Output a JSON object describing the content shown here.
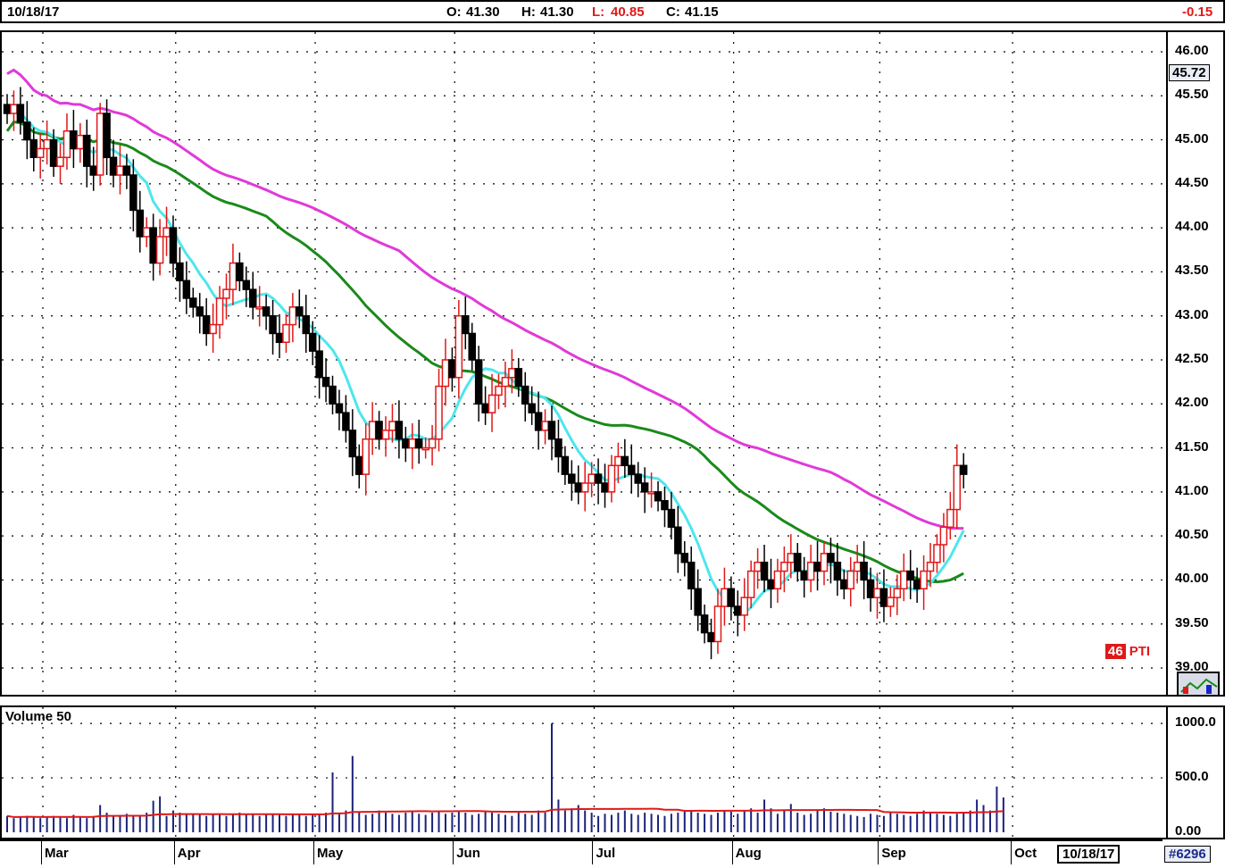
{
  "header": {
    "date": "10/18/17",
    "open_label": "O:",
    "open": "41.30",
    "high_label": "H:",
    "high": "41.30",
    "low_label": "L:",
    "low": "40.85",
    "close_label": "C:",
    "close": "41.15",
    "change": "-0.15"
  },
  "colors": {
    "up_bar": "#e01818",
    "down_bar": "#000000",
    "cyan_ma": "#4ee6ee",
    "green_ma": "#1a8a1a",
    "magenta_ma": "#e03ad8",
    "wave_blue": "#1b22c8",
    "wave_red": "#e01818"
  },
  "price_axis": {
    "ticks": [
      "46.00",
      "45.50",
      "45.00",
      "44.50",
      "44.00",
      "43.50",
      "43.00",
      "42.50",
      "42.00",
      "41.50",
      "41.00",
      "40.50",
      "40.00",
      "39.50",
      "39.00"
    ],
    "current": "45.72"
  },
  "volume_panel": {
    "title": "Volume 50",
    "ticks": [
      "1000.0",
      "500.0",
      "0.00"
    ]
  },
  "x_axis": {
    "months": [
      "Mar",
      "Apr",
      "May",
      "Jun",
      "Jul",
      "Aug",
      "Sep",
      "Oct"
    ],
    "current_date": "10/18/17",
    "id": "#6296"
  },
  "indicator": {
    "value": "46",
    "label": "PTI"
  },
  "chart_data": {
    "type": "bar",
    "title": "",
    "ylim": [
      38.95,
      46.25
    ],
    "volume_ylim": [
      0,
      1050
    ],
    "grid": true,
    "bar_count": 165,
    "month_start_index": [
      0,
      20,
      41,
      62,
      83,
      104,
      126,
      146
    ],
    "close": [
      45.3,
      45.4,
      45.2,
      45.0,
      44.8,
      44.9,
      45.0,
      44.7,
      44.8,
      45.1,
      44.9,
      45.05,
      44.7,
      44.6,
      45.3,
      44.8,
      44.6,
      44.7,
      44.6,
      44.2,
      43.9,
      44.0,
      43.6,
      43.9,
      44.0,
      43.6,
      43.4,
      43.2,
      43.1,
      43.0,
      42.8,
      42.9,
      43.2,
      43.3,
      43.6,
      43.4,
      43.3,
      43.1,
      43.1,
      43.0,
      42.8,
      42.7,
      42.9,
      43.1,
      43.0,
      42.8,
      42.6,
      42.3,
      42.2,
      42.0,
      41.9,
      41.7,
      41.4,
      41.2,
      41.6,
      41.8,
      41.6,
      41.7,
      41.8,
      41.6,
      41.5,
      41.6,
      41.5,
      41.5,
      41.6,
      42.2,
      42.5,
      42.3,
      43.0,
      42.8,
      42.5,
      42.0,
      41.9,
      42.1,
      42.2,
      42.3,
      42.4,
      42.2,
      42.0,
      41.9,
      41.7,
      41.8,
      41.6,
      41.4,
      41.2,
      41.1,
      41.0,
      41.1,
      41.2,
      41.1,
      41.0,
      41.3,
      41.4,
      41.3,
      41.2,
      41.1,
      41.0,
      41.0,
      40.9,
      40.8,
      40.6,
      40.3,
      40.2,
      39.9,
      39.6,
      39.4,
      39.3,
      39.7,
      39.9,
      39.7,
      39.6,
      39.8,
      40.1,
      40.2,
      40.0,
      39.9,
      40.1,
      40.2,
      40.3,
      40.1,
      40.0,
      40.2,
      40.1,
      40.3,
      40.2,
      40.0,
      39.9,
      40.1,
      40.2,
      40.0,
      39.8,
      39.9,
      39.7,
      39.8,
      39.9,
      40.1,
      40.0,
      39.9,
      40.1,
      40.2,
      40.4,
      40.6,
      40.8,
      41.3,
      41.2
    ],
    "volume": [
      150,
      130,
      140,
      150,
      140,
      130,
      140,
      150,
      140,
      130,
      160,
      140,
      130,
      150,
      250,
      180,
      150,
      160,
      170,
      150,
      150,
      180,
      290,
      330,
      150,
      200,
      180,
      170,
      160,
      170,
      150,
      160,
      170,
      150,
      160,
      180,
      170,
      160,
      150,
      160,
      170,
      160,
      150,
      170,
      160,
      150,
      170,
      160,
      180,
      550,
      180,
      200,
      700,
      180,
      160,
      170,
      200,
      180,
      170,
      160,
      180,
      200,
      170,
      160,
      180,
      190,
      170,
      180,
      200,
      180,
      160,
      170,
      190,
      180,
      170,
      160,
      150,
      180,
      170,
      160,
      200,
      180,
      1000,
      300,
      200,
      220,
      250,
      200,
      180,
      150,
      170,
      160,
      180,
      200,
      170,
      160,
      180,
      170,
      160,
      150,
      170,
      180,
      200,
      190,
      180,
      170,
      160,
      180,
      200,
      190,
      170,
      200,
      220,
      180,
      300,
      220,
      170,
      200,
      260,
      180,
      160,
      170,
      200,
      220,
      190,
      180,
      170,
      160,
      150,
      140,
      170,
      160,
      150,
      180,
      170,
      160,
      150,
      170,
      200,
      180,
      170,
      160,
      150,
      170,
      180,
      200,
      300,
      250,
      200,
      420,
      320
    ]
  }
}
